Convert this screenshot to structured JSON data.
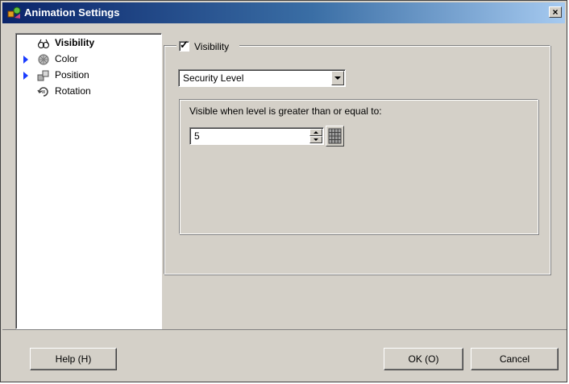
{
  "window": {
    "title": "Animation Settings",
    "close_glyph": "×"
  },
  "tree": {
    "items": [
      {
        "label": "Visibility",
        "icon": "glasses-icon",
        "selected": true,
        "has_arrow": false
      },
      {
        "label": "Color",
        "icon": "color-wheel-icon",
        "selected": false,
        "has_arrow": true
      },
      {
        "label": "Position",
        "icon": "position-blocks-icon",
        "selected": false,
        "has_arrow": true
      },
      {
        "label": "Rotation",
        "icon": "rotation-icon",
        "selected": false,
        "has_arrow": false
      }
    ]
  },
  "visibility": {
    "checkbox_label": "Visibility",
    "checked": true,
    "check_mark": "✓",
    "mode_select": "Security Level",
    "condition_label": "Visible when level is greater than or equal to:",
    "level_value": "5"
  },
  "buttons": {
    "help": "Help (H)",
    "ok": "OK (O)",
    "cancel": "Cancel"
  },
  "colors": {
    "face": "#d4d0c8",
    "title_start": "#0a246a",
    "title_end": "#a6caf0",
    "arrow": "#1a3cff"
  }
}
